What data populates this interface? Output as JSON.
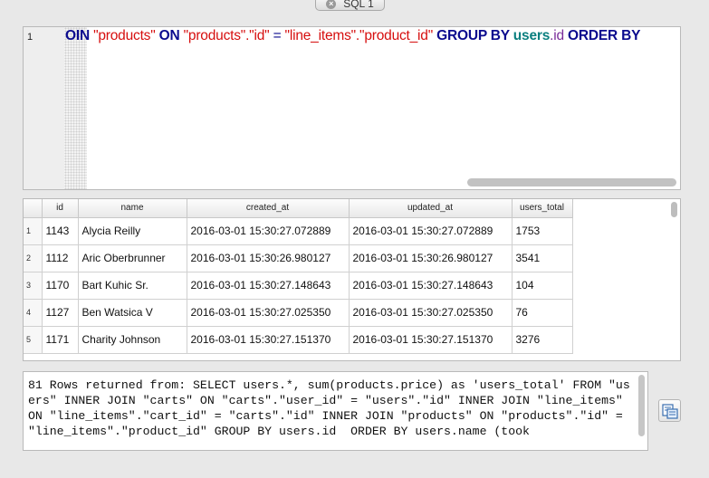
{
  "tab": {
    "label": "SQL 1"
  },
  "editor": {
    "line_number": "1",
    "tokens": [
      {
        "text": "OIN ",
        "kind": "kw"
      },
      {
        "text": "\"products\"",
        "kind": "str"
      },
      {
        "text": " ON ",
        "kind": "kw"
      },
      {
        "text": "\"products\".\"id\"",
        "kind": "str"
      },
      {
        "text": " = ",
        "kind": "op"
      },
      {
        "text": "\"line_items\".\"product_id\"",
        "kind": "str"
      },
      {
        "text": " GROUP BY ",
        "kind": "kw"
      },
      {
        "text": "users",
        "kind": "tbl"
      },
      {
        "text": ".id",
        "kind": "col"
      },
      {
        "text": "  ORDER BY",
        "kind": "kw"
      }
    ]
  },
  "results": {
    "columns": [
      "id",
      "name",
      "created_at",
      "updated_at",
      "users_total"
    ],
    "rows": [
      {
        "n": "1",
        "cells": [
          "1143",
          "Alycia Reilly",
          "2016-03-01 15:30:27.072889",
          "2016-03-01 15:30:27.072889",
          "1753"
        ]
      },
      {
        "n": "2",
        "cells": [
          "1112",
          "Aric Oberbrunner",
          "2016-03-01 15:30:26.980127",
          "2016-03-01 15:30:26.980127",
          "3541"
        ]
      },
      {
        "n": "3",
        "cells": [
          "1170",
          "Bart Kuhic Sr.",
          "2016-03-01 15:30:27.148643",
          "2016-03-01 15:30:27.148643",
          "104"
        ]
      },
      {
        "n": "4",
        "cells": [
          "1127",
          "Ben Watsica V",
          "2016-03-01 15:30:27.025350",
          "2016-03-01 15:30:27.025350",
          "76"
        ]
      },
      {
        "n": "5",
        "cells": [
          "1171",
          "Charity Johnson",
          "2016-03-01 15:30:27.151370",
          "2016-03-01 15:30:27.151370",
          "3276"
        ]
      }
    ]
  },
  "message": {
    "text": "81 Rows returned from: SELECT users.*, sum(products.price) as 'users_total' FROM \"users\" INNER JOIN \"carts\" ON \"carts\".\"user_id\" = \"users\".\"id\" INNER JOIN \"line_items\" ON \"line_items\".\"cart_id\" = \"carts\".\"id\" INNER JOIN \"products\" ON \"products\".\"id\" = \"line_items\".\"product_id\" GROUP BY users.id  ORDER BY users.name (took"
  },
  "icons": {
    "tab_close": "close-icon",
    "export": "export-icon"
  },
  "colors": {
    "keyword": "#0b0b8e",
    "string": "#d60e0e",
    "table": "#0a7f7f",
    "column": "#7a2d9a"
  }
}
